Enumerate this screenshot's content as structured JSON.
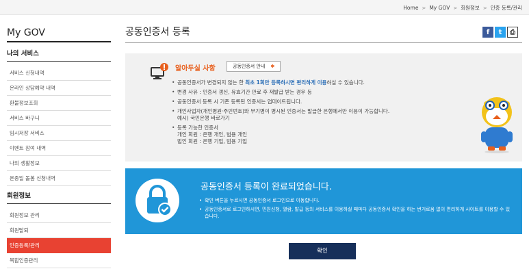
{
  "breadcrumb": [
    "Home",
    "My GOV",
    "회원정보",
    "인증 등록/관리"
  ],
  "sidebar": {
    "title": "My GOV",
    "sections": [
      {
        "heading": "나의 서비스",
        "items": [
          {
            "label": "서비스 신청내역"
          },
          {
            "label": "온라인 상담예약 내역"
          },
          {
            "label": "환불정보조회"
          },
          {
            "label": "서비스 바구니"
          },
          {
            "label": "임시저장 서비스"
          },
          {
            "label": "이벤트 참여 내역"
          },
          {
            "label": "나의 생활정보"
          },
          {
            "label": "온종일 돌봄 신청내역"
          }
        ]
      },
      {
        "heading": "회원정보",
        "items": [
          {
            "label": "회원정보 관리"
          },
          {
            "label": "회원탈퇴"
          },
          {
            "label": "인증등록/관리",
            "active": true
          },
          {
            "label": "복합인증관리"
          }
        ]
      }
    ]
  },
  "page": {
    "title": "공동인증서 등록",
    "share_labels": {
      "facebook": "f",
      "twitter": "t",
      "print": "⎙"
    }
  },
  "notice": {
    "heading": "알아두실 사항",
    "guide_button": "공동인증서 안내",
    "guide_star": "✱",
    "items": [
      {
        "pre": "공동인증서가 변경되지 않는 한 ",
        "em": "최초 1회만 등록하시면 편리하게 이용",
        "post": "하실 수 있습니다."
      },
      {
        "text": "변경 사유 : 인증서 갱신, 유효기간 만료 후 재발급 받는 경우 등"
      },
      {
        "text": "공동인증서 등록 시 기존 등록된 인증서는 업데이트됩니다."
      },
      {
        "text": "개인사업자(개인병원·주민번호)와 부기명이 명시된 인증서는 발급한 은행에서만 이용이 가능합니다.",
        "sub": "예시) 국민은행 바로가기"
      },
      {
        "text": "등록 가능한 인증서",
        "sub": "개인 회원 : 은행 개인, 범용 개인",
        "sub2": "법인 회원 : 은행 기업, 범용 기업"
      }
    ]
  },
  "complete": {
    "title": "공동인증서 등록이 완료되었습니다.",
    "items": [
      "확인 버튼을 누르시면 공동인증서 로그인으로 이동합니다.",
      "공동인증서로 로그인하시면, 민원신청, 열람, 발급 등의 서비스를 이용하실 때마다 공동인증서 확인을 하는 번거로움 없이 편리하게 사이트를 이용할 수 있습니다."
    ]
  },
  "confirm_label": "확인",
  "colors": {
    "accent_orange": "#e8601e",
    "active_menu": "#e84232",
    "complete_bg": "#2096d8",
    "confirm_bg": "#162f5a"
  }
}
